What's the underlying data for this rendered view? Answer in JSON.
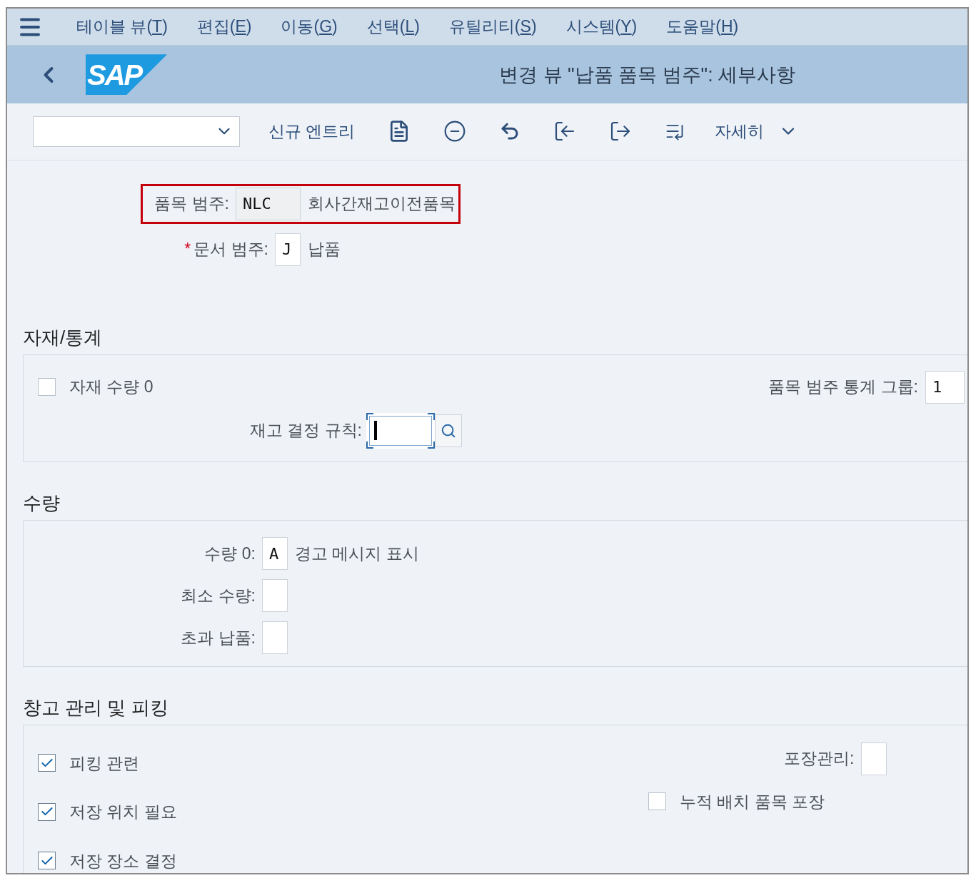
{
  "menu_bar": {
    "items": [
      "테이블 뷰(T)",
      "편집(E)",
      "이동(G)",
      "선택(L)",
      "유틸리티(S)",
      "시스템(Y)",
      "도움말(H)"
    ]
  },
  "header": {
    "logo": "SAP",
    "title": "변경 뷰 \"납품 품목 범주\": 세부사항"
  },
  "toolbar": {
    "new_entry": "신규 엔트리",
    "more": "자세히"
  },
  "key_fields": [
    {
      "label": "품목 범주:",
      "value": "NLC",
      "description": "회사간재고이전품목",
      "editable": false,
      "highlighted": true
    },
    {
      "required_mark": "*",
      "label": "문서 범주:",
      "value": "J",
      "description": "납품",
      "editable": true,
      "highlighted": false
    }
  ],
  "material_statistics": {
    "title": "자재/통계",
    "zero_quantity": {
      "label": "자재 수량 0",
      "checked": false
    },
    "statistics_group": {
      "label": "품목 범주 통계 그룹:",
      "value": "1"
    },
    "stock_rule": {
      "label": "재고 결정 규칙:",
      "focused": true
    }
  },
  "quantity": {
    "title": "수량",
    "rows": [
      {
        "label": "수량 0:",
        "value": "A",
        "description": "경고 메시지 표시"
      },
      {
        "label": "최소 수량:"
      },
      {
        "label": "초과 납품:"
      }
    ]
  },
  "warehouse": {
    "title": "창고 관리 및 피킹",
    "checks": [
      {
        "label": "피킹 관련",
        "checked": true
      },
      {
        "label": "저장 위치 필요",
        "checked": true
      },
      {
        "label": "저장 장소 결정",
        "checked": true
      }
    ],
    "packaging": {
      "label": "포장관리:"
    },
    "batch_packing": {
      "label": "누적 배치 품목 포장",
      "checked": false
    }
  }
}
